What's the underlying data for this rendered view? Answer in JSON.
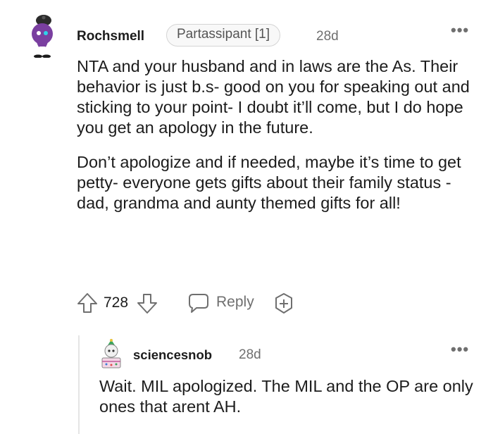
{
  "comment": {
    "username": "Rochsmell",
    "flair": "Partassipant [1]",
    "age": "28d",
    "more_icon": "more-dots-icon",
    "paragraphs": [
      "NTA and your husband and in laws are the As. Their behavior is just b.s- good on you for speaking out and sticking to your point- I doubt it’ll come, but I do hope you get an apology in the future.",
      "Don’t apologize and if needed, maybe it’s time to get petty- everyone gets gifts about their family status - dad, grandma and aunty themed gifts for all!"
    ],
    "votes": "728",
    "reply_label": "Reply",
    "avatar_icon": "purple-snoo-avatar-icon",
    "award_icon": "award-plus-icon"
  },
  "reply": {
    "username": "sciencesnob",
    "age": "28d",
    "more_icon": "more-dots-icon",
    "text": "Wait. MIL apologized. The MIL and the OP are only ones that arent AH.",
    "avatar_icon": "cake-snoo-avatar-icon"
  },
  "colors": {
    "text": "#1c1c1c",
    "muted": "#6f6f6f",
    "avatar_purple": "#7a3fa0",
    "thread_line": "#e5e5e5"
  }
}
